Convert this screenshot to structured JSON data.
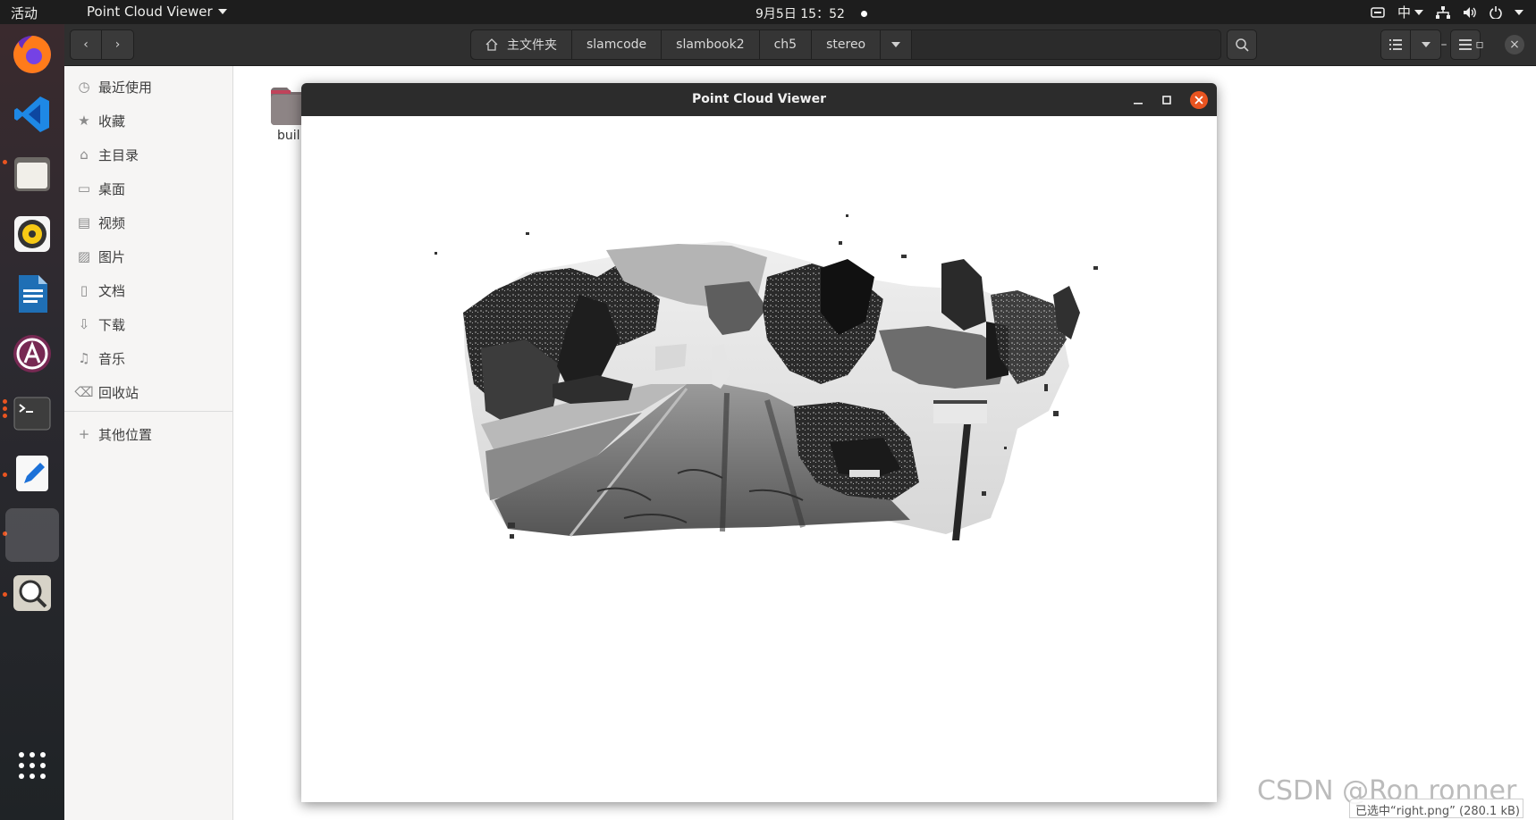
{
  "topbar": {
    "activities": "活动",
    "app_name": "Point Cloud Viewer",
    "clock": "9月5日  15：52",
    "ime": "中"
  },
  "dock": {
    "items": [
      "firefox-icon",
      "vscode-icon",
      "files-icon",
      "rhythmbox-icon",
      "writer-icon",
      "software-icon",
      "terminal-icon",
      "text-editor-icon",
      "point-cloud-viewer-icon",
      "image-viewer-icon",
      "show-apps-icon"
    ]
  },
  "files": {
    "breadcrumbs": [
      "主文件夹",
      "slamcode",
      "slambook2",
      "ch5",
      "stereo"
    ],
    "sidebar": [
      {
        "label": "最近使用",
        "icon": "clock-icon"
      },
      {
        "label": "收藏",
        "icon": "star-icon"
      },
      {
        "label": "主目录",
        "icon": "home-icon"
      },
      {
        "label": "桌面",
        "icon": "desktop-icon"
      },
      {
        "label": "视频",
        "icon": "video-icon"
      },
      {
        "label": "图片",
        "icon": "picture-icon"
      },
      {
        "label": "文档",
        "icon": "document-icon"
      },
      {
        "label": "下载",
        "icon": "download-icon"
      },
      {
        "label": "音乐",
        "icon": "music-icon"
      },
      {
        "label": "回收站",
        "icon": "trash-icon"
      }
    ],
    "other_places": "其他位置",
    "folder_label": "buil",
    "status": "已选中“right.png”  (280.1 kB)"
  },
  "viewer": {
    "title": "Point Cloud Viewer"
  },
  "watermark": "CSDN @Ron   ronner"
}
